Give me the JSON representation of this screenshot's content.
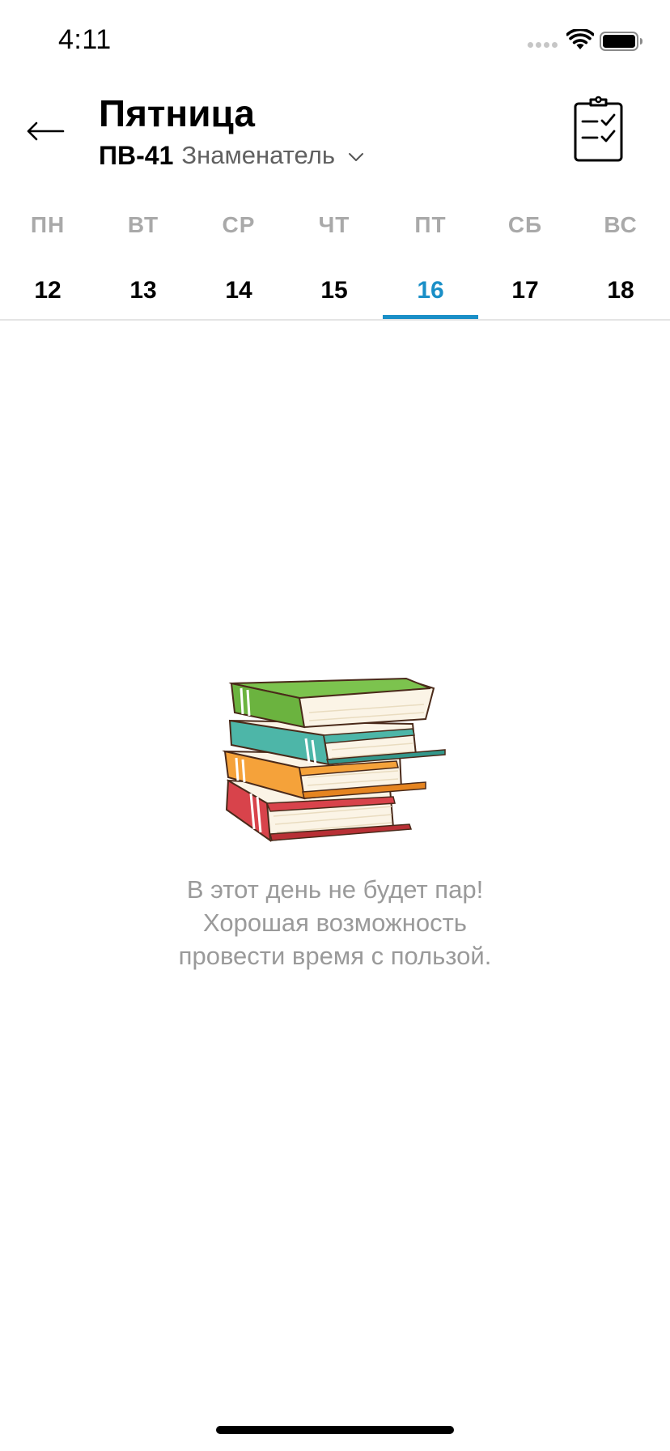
{
  "status_bar": {
    "time": "4:11",
    "icons": [
      "signal-dots-icon",
      "wifi-icon",
      "battery-icon"
    ]
  },
  "header": {
    "back_icon": "arrow-left-icon",
    "title": "Пятница",
    "group": "ПВ-41",
    "week_type": "Знаменатель",
    "dropdown_icon": "chevron-down-icon",
    "tasks_icon": "clipboard-checklist-icon"
  },
  "week": {
    "days": [
      {
        "name": "ПН",
        "number": "12"
      },
      {
        "name": "ВТ",
        "number": "13"
      },
      {
        "name": "СР",
        "number": "14"
      },
      {
        "name": "ЧТ",
        "number": "15"
      },
      {
        "name": "ПТ",
        "number": "16"
      },
      {
        "name": "СБ",
        "number": "17"
      },
      {
        "name": "ВС",
        "number": "18"
      }
    ],
    "selected_index": 4
  },
  "colors": {
    "accent": "#1a8fc7",
    "muted_text": "#9a9a9a",
    "day_label": "#a9a9a9"
  },
  "empty_state": {
    "illustration": "stack-of-books",
    "lines": [
      "В этот день не будет пар!",
      "Хорошая возможность",
      "провести время с пользой."
    ]
  }
}
